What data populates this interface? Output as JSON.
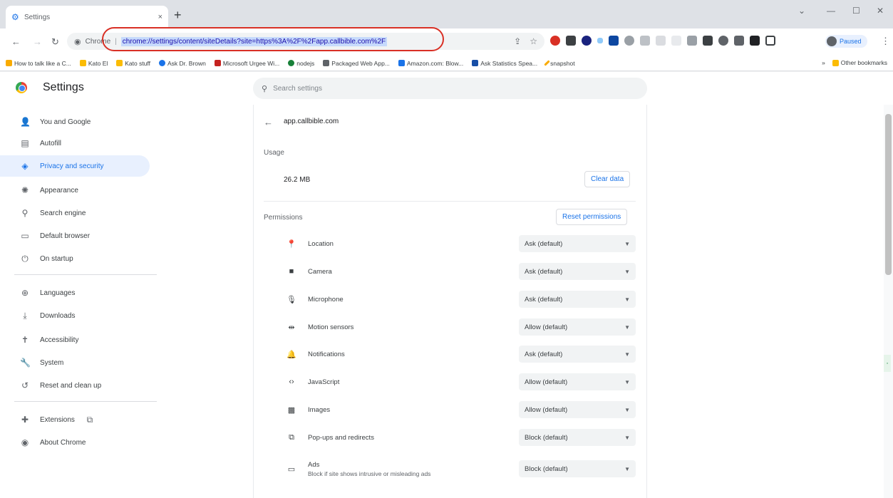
{
  "browser": {
    "tab_title": "Settings",
    "tab_close": "×",
    "new_tab": "+",
    "omnibox": {
      "scheme_label": "Chrome",
      "separator": "|",
      "url": "chrome://settings/content/siteDetails?site=https%3A%2F%2Fapp.callbible.com%2F"
    },
    "profile_label": "Paused",
    "window_controls": [
      "⌄",
      "—",
      "☐",
      "✕"
    ]
  },
  "bookmarks": {
    "items": [
      {
        "label": "How to talk like a C...",
        "color": "#f9ab00"
      },
      {
        "label": "Kato El",
        "color": "#fbbc04"
      },
      {
        "label": "Kato stuff",
        "color": "#fbbc04"
      },
      {
        "label": "Ask Dr. Brown",
        "color": "#1a73e8"
      },
      {
        "label": "Microsoft Urgee Wi...",
        "color": "#c5221f"
      },
      {
        "label": "nodejs",
        "color": "#188038"
      },
      {
        "label": "Packaged Web App...",
        "color": "#5f6368"
      },
      {
        "label": "Amazon.com: Blow...",
        "color": "#1a73e8"
      },
      {
        "label": "Ask Statistics Spea...",
        "color": "#174ea6"
      },
      {
        "label": "snapshot",
        "color": "#f9ab00"
      }
    ],
    "other": "Other bookmarks"
  },
  "settings": {
    "title": "Settings",
    "search_placeholder": "Search settings"
  },
  "sidebar": {
    "items": [
      {
        "label": "You and Google",
        "icon": "👤",
        "name": "you-and-google"
      },
      {
        "label": "Autofill",
        "icon": "▤",
        "name": "autofill"
      },
      {
        "label": "Privacy and security",
        "icon": "◈",
        "name": "privacy-and-security"
      },
      {
        "label": "Appearance",
        "icon": "✺",
        "name": "appearance"
      },
      {
        "label": "Search engine",
        "icon": "⚲",
        "name": "search-engine"
      },
      {
        "label": "Default browser",
        "icon": "▭",
        "name": "default-browser"
      },
      {
        "label": "On startup",
        "icon": "⏻",
        "name": "on-startup"
      },
      {
        "label": "Languages",
        "icon": "⊕",
        "name": "languages"
      },
      {
        "label": "Downloads",
        "icon": "⤓",
        "name": "downloads"
      },
      {
        "label": "Accessibility",
        "icon": "✝",
        "name": "accessibility"
      },
      {
        "label": "System",
        "icon": "🔧",
        "name": "system"
      },
      {
        "label": "Reset and clean up",
        "icon": "↺",
        "name": "reset-and-clean-up"
      },
      {
        "label": "Extensions",
        "icon": "✚",
        "name": "extensions"
      },
      {
        "label": "About Chrome",
        "icon": "◉",
        "name": "about-chrome"
      }
    ],
    "extensions_external": "⧉"
  },
  "site": {
    "name": "app.callbible.com",
    "usage_heading": "Usage",
    "usage_value": "26.2 MB",
    "clear_data": "Clear data",
    "permissions_heading": "Permissions",
    "reset_permissions": "Reset permissions",
    "permissions": [
      {
        "label": "Location",
        "value": "Ask (default)",
        "icon": "📍"
      },
      {
        "label": "Camera",
        "value": "Ask (default)",
        "icon": "■"
      },
      {
        "label": "Microphone",
        "value": "Ask (default)",
        "icon": "🎙"
      },
      {
        "label": "Motion sensors",
        "value": "Allow (default)",
        "icon": "⇹"
      },
      {
        "label": "Notifications",
        "value": "Ask (default)",
        "icon": "🔔"
      },
      {
        "label": "JavaScript",
        "value": "Allow (default)",
        "icon": "‹›"
      },
      {
        "label": "Images",
        "value": "Allow (default)",
        "icon": "▩"
      },
      {
        "label": "Pop-ups and redirects",
        "value": "Block (default)",
        "icon": "⧉"
      },
      {
        "label": "Ads",
        "sublabel": "Block if site shows intrusive or misleading ads",
        "value": "Block (default)",
        "icon": "▭"
      }
    ]
  }
}
